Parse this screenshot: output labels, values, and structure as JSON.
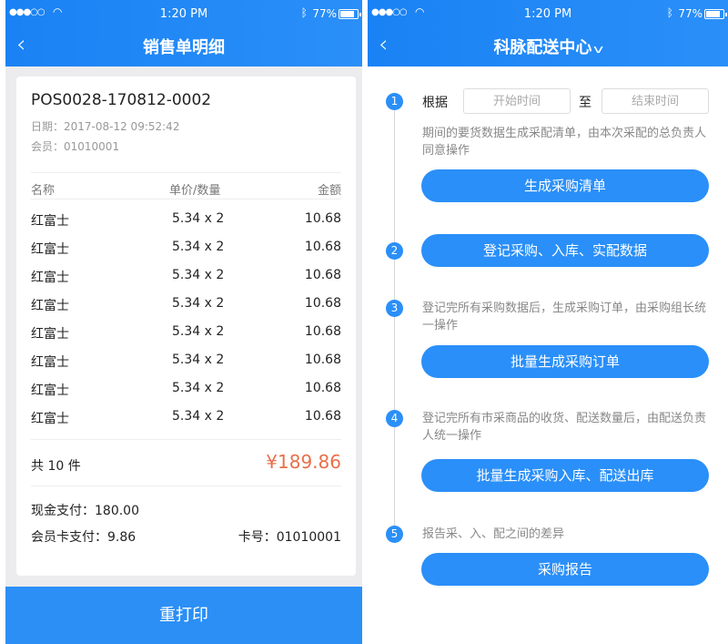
{
  "status_bar": {
    "signal": "●●●○○",
    "time": "1:20 PM",
    "battery": "77%"
  },
  "left": {
    "title": "销售单明细",
    "order_no": "POS0028-170812-0002",
    "date": "日期：2017-08-12 09:52:42",
    "member": "会员：01010001",
    "columns": {
      "name": "名称",
      "price_qty": "单价/数量",
      "amount": "金额"
    },
    "items": [
      {
        "name": "红富士",
        "price_qty": "5.34 x 2",
        "amount": "10.68"
      },
      {
        "name": "红富士",
        "price_qty": "5.34 x 2",
        "amount": "10.68"
      },
      {
        "name": "红富士",
        "price_qty": "5.34 x 2",
        "amount": "10.68"
      },
      {
        "name": "红富士",
        "price_qty": "5.34 x 2",
        "amount": "10.68"
      },
      {
        "name": "红富士",
        "price_qty": "5.34 x 2",
        "amount": "10.68"
      },
      {
        "name": "红富士",
        "price_qty": "5.34 x 2",
        "amount": "10.68"
      },
      {
        "name": "红富士",
        "price_qty": "5.34 x 2",
        "amount": "10.68"
      },
      {
        "name": "红富士",
        "price_qty": "5.34 x 2",
        "amount": "10.68"
      }
    ],
    "total_count": "共 10 件",
    "total_amount": "¥189.86",
    "cash_payment": "现金支付：180.00",
    "card_payment": "会员卡支付：9.86",
    "card_no": "卡号：01010001",
    "reprint": "重打印"
  },
  "right": {
    "title": "科脉配送中心",
    "steps": [
      {
        "num": "1",
        "basis_label": "根据",
        "start_placeholder": "开始时间",
        "to_label": "至",
        "end_placeholder": "结束时间",
        "desc": "期间的要货数据生成采配清单，由本次采配的总负责人同意操作",
        "button": "生成采购清单"
      },
      {
        "num": "2",
        "button": "登记采购、入库、实配数据"
      },
      {
        "num": "3",
        "desc": "登记完所有采购数据后，生成采购订单，由采购组长统一操作",
        "button": "批量生成采购订单"
      },
      {
        "num": "4",
        "desc": "登记完所有市采商品的收货、配送数量后，由配送负责人统一操作",
        "button": "批量生成采购入库、配送出库"
      },
      {
        "num": "5",
        "desc": "报告采、入、配之间的差异",
        "button": "采购报告"
      }
    ]
  },
  "colors": {
    "primary": "#2a8ff8",
    "total": "#e8704a"
  }
}
